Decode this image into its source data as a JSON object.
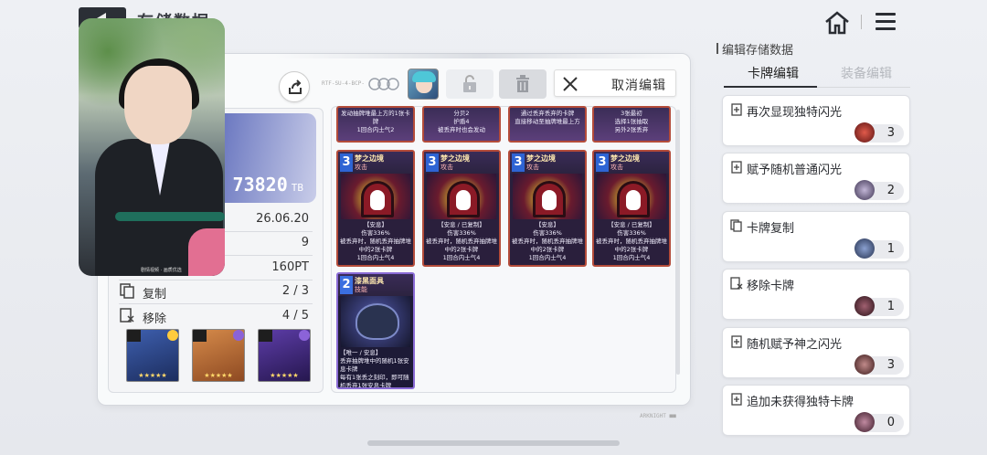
{
  "header": {
    "title": "存储数据"
  },
  "toolbar": {
    "code": "RTF-SU-4-BCP-",
    "cancel_label": "取消编辑"
  },
  "save_info": {
    "tb_value": "73820",
    "tb_unit": "TB",
    "date": "26.06.20",
    "number": "9",
    "points": "160PT",
    "copy_label": "复制",
    "copy_value": "2 / 3",
    "remove_label": "移除",
    "remove_value": "4 / 5"
  },
  "equipment": [
    {
      "icon": "sword-icon",
      "stars": "★★★★★"
    },
    {
      "icon": "furnace-icon",
      "stars": "★★★★★"
    },
    {
      "icon": "crystal-icon",
      "stars": "★★★★★"
    }
  ],
  "cards_top": [
    {
      "text": "发动抽牌堆最上方的1张卡牌\n1回合内士气2"
    },
    {
      "text": "分贝2\n护盾4\n被丢弃时也会发动"
    },
    {
      "text": "通过丢弃丢弃的卡牌\n直接移动至抽牌堆最上方"
    },
    {
      "text": "3张最初\n选择1张抽取\n另外2张丢弃"
    }
  ],
  "cards": [
    {
      "cost": "3",
      "name": "梦之边境",
      "tag": "攻击",
      "desc": "【安息】\n伤害336%\n被丢弃时，随机丢弃抽牌堆中的2张卡牌\n1回合内士气4"
    },
    {
      "cost": "3",
      "name": "梦之边境",
      "tag": "攻击",
      "desc": "【安息 / 已复制】\n伤害336%\n被丢弃时，随机丢弃抽牌堆中的2张卡牌\n1回合内士气4"
    },
    {
      "cost": "3",
      "name": "梦之边境",
      "tag": "攻击",
      "desc": "【安息】\n伤害336%\n被丢弃时，随机丢弃抽牌堆中的2张卡牌\n1回合内士气4"
    },
    {
      "cost": "3",
      "name": "梦之边境",
      "tag": "攻击",
      "desc": "【安息 / 已复制】\n伤害336%\n被丢弃时，随机丢弃抽牌堆中的2张卡牌\n1回合内士气4"
    }
  ],
  "skill_card": {
    "cost": "2",
    "name": "漆黑面具",
    "tag": "技能",
    "desc": "【唯一 / 安息】\n丢弃抽牌堆中的随机1张安息卡牌\n每有1张丢之刻印，即可随机丢弃1张安息卡牌\n被丢弃时，发动此卡"
  },
  "sidebar": {
    "title": "编辑存储数据",
    "tab_cards": "卡牌编辑",
    "tab_equipment": "装备编辑",
    "items": [
      {
        "label": "再次显现独特闪光",
        "count": "3",
        "orb_color": "#b23a3a"
      },
      {
        "label": "赋予随机普通闪光",
        "count": "2",
        "orb_color": "#8a7aa0"
      },
      {
        "label": "卡牌复制",
        "count": "1",
        "orb_color": "#4a5d8a"
      },
      {
        "label": "移除卡牌",
        "count": "1",
        "orb_color": "#5c3a44"
      },
      {
        "label": "随机赋予神之闪光",
        "count": "3",
        "orb_color": "#6a3d3d"
      },
      {
        "label": "追加未获得独特卡牌",
        "count": "0",
        "orb_color": "#7a4a5a"
      }
    ]
  },
  "video": {
    "caption": "剧情视频 · 画质优选"
  },
  "footer": {
    "brand": "ARKNIGHT ■■"
  }
}
